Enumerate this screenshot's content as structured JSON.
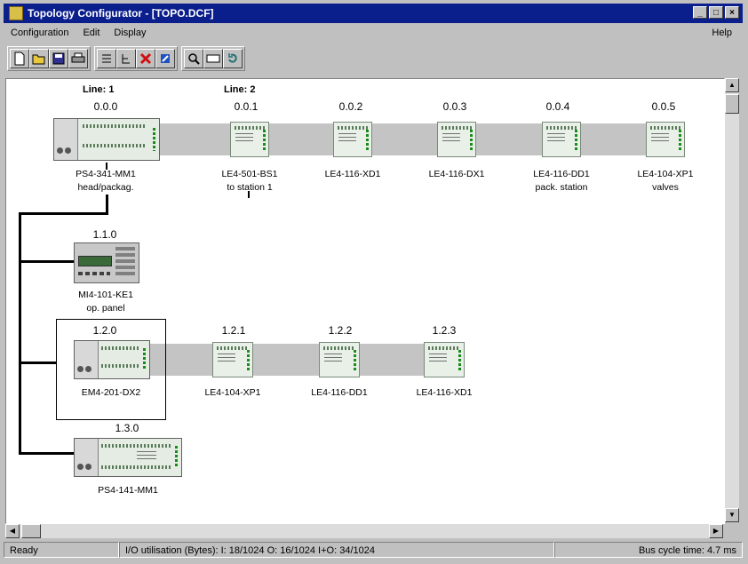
{
  "window": {
    "title": "Topology Configurator - [TOPO.DCF]",
    "controls": {
      "minimize": "_",
      "maximize": "□",
      "close": "×"
    }
  },
  "menu": {
    "items": [
      "Configuration",
      "Edit",
      "Display"
    ],
    "help": "Help"
  },
  "toolbar": {
    "groups": [
      [
        "new-icon",
        "open-icon",
        "save-icon",
        "print-icon"
      ],
      [
        "list-icon",
        "tree-icon",
        "delete-icon",
        "tools-icon"
      ],
      [
        "zoom-icon",
        "view-icon",
        "refresh-icon"
      ]
    ]
  },
  "lines": {
    "line1": "Line: 1",
    "line2": "Line: 2"
  },
  "stations": [
    {
      "addr": "0.0.0",
      "name": "PS4-341-MM1",
      "desc": "head/packag."
    },
    {
      "addr": "0.0.1",
      "name": "LE4-501-BS1",
      "desc": "to station 1"
    },
    {
      "addr": "0.0.2",
      "name": "LE4-116-XD1",
      "desc": ""
    },
    {
      "addr": "0.0.3",
      "name": "LE4-116-DX1",
      "desc": ""
    },
    {
      "addr": "0.0.4",
      "name": "LE4-116-DD1",
      "desc": "pack. station"
    },
    {
      "addr": "0.0.5",
      "name": "LE4-104-XP1",
      "desc": "valves"
    },
    {
      "addr": "1.1.0",
      "name": "MI4-101-KE1",
      "desc": "op. panel"
    },
    {
      "addr": "1.2.0",
      "name": "EM4-201-DX2",
      "desc": ""
    },
    {
      "addr": "1.2.1",
      "name": "LE4-104-XP1",
      "desc": ""
    },
    {
      "addr": "1.2.2",
      "name": "LE4-116-DD1",
      "desc": ""
    },
    {
      "addr": "1.2.3",
      "name": "LE4-116-XD1",
      "desc": ""
    },
    {
      "addr": "1.3.0",
      "name": "PS4-141-MM1",
      "desc": ""
    }
  ],
  "status": {
    "ready": "Ready",
    "io": "I/O utilisation (Bytes):  I: 18/1024  O: 16/1024  I+O: 34/1024",
    "cycle": "Bus cycle time:  4.7 ms"
  }
}
